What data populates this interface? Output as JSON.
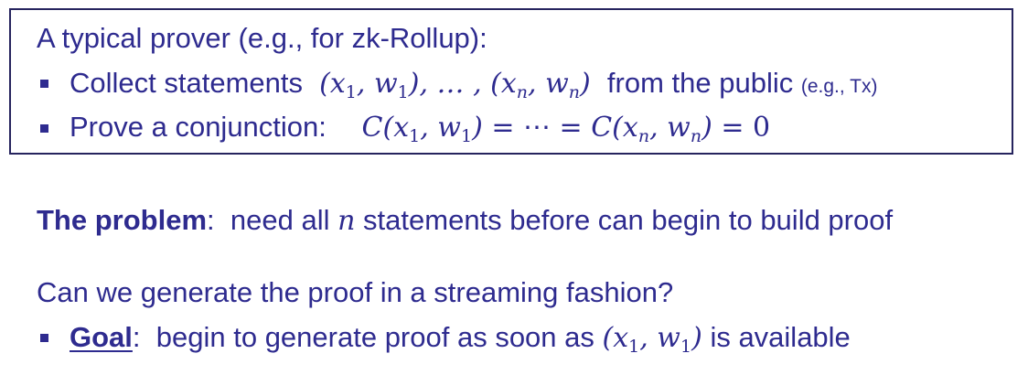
{
  "box": {
    "title": "A typical prover (e.g., for zk-Rollup):",
    "bullet1": {
      "prefix": "Collect statements",
      "suffix": "from the public",
      "note": "(e.g., Tx)"
    },
    "bullet2": {
      "prefix": "Prove a conjunction:"
    }
  },
  "problem": {
    "label": "The problem",
    "colon": ":",
    "text_before": "need all",
    "text_after": "statements before can begin to build proof"
  },
  "question": "Can we generate the proof in a streaming fashion?",
  "goal": {
    "label": "Goal",
    "colon": ":",
    "text_before": "begin to generate proof as soon as",
    "text_after": "is available"
  },
  "colors": {
    "text": "#2e2b8f",
    "border": "#26245e"
  }
}
